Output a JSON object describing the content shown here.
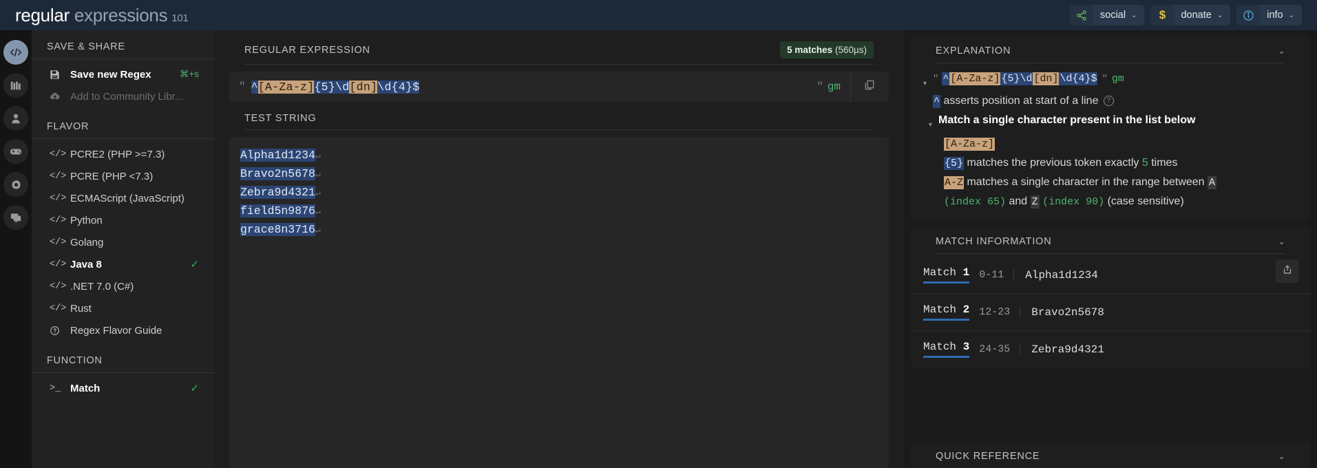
{
  "header": {
    "logo": {
      "word1": "regular",
      "word2": "expressions",
      "num": "101"
    },
    "actions": [
      {
        "icon": "share-nodes-icon",
        "glyph": "⑃",
        "label": "social",
        "caret": "⌄",
        "color": "#6fbf52"
      },
      {
        "icon": "dollar-icon",
        "glyph": "$",
        "label": "donate",
        "caret": "⌄",
        "color": "#e6c239"
      },
      {
        "icon": "info-circle-icon",
        "glyph": "ⓘ",
        "label": "info",
        "caret": "⌄",
        "color": "#5fb4e0"
      }
    ]
  },
  "rail": {
    "items": [
      {
        "name": "code-icon",
        "active": true
      },
      {
        "name": "library-icon",
        "active": false
      },
      {
        "name": "account-icon",
        "active": false
      },
      {
        "name": "gamepad-icon",
        "active": false
      },
      {
        "name": "settings-gear-icon",
        "active": false
      },
      {
        "name": "comments-icon",
        "active": false
      }
    ]
  },
  "sidebar": {
    "save_share_title": "SAVE & SHARE",
    "save_new_regex": {
      "label": "Save new Regex",
      "shortcut": "⌘+s",
      "icon": "floppy-disk-icon"
    },
    "add_community": {
      "label": "Add to Community Libr...",
      "icon": "cloud-upload-icon"
    },
    "flavor_title": "FLAVOR",
    "flavors": [
      {
        "label": "PCRE2 (PHP >=7.3)",
        "selected": false
      },
      {
        "label": "PCRE (PHP <7.3)",
        "selected": false
      },
      {
        "label": "ECMAScript (JavaScript)",
        "selected": false
      },
      {
        "label": "Python",
        "selected": false
      },
      {
        "label": "Golang",
        "selected": false
      },
      {
        "label": "Java 8",
        "selected": true
      },
      {
        "label": ".NET 7.0 (C#)",
        "selected": false
      },
      {
        "label": "Rust",
        "selected": false
      }
    ],
    "flavor_guide": {
      "label": "Regex Flavor Guide",
      "icon": "question-circle-icon"
    },
    "function_title": "FUNCTION",
    "functions": [
      {
        "label": "Match",
        "selected": true,
        "icon": "terminal-icon"
      }
    ],
    "check_glyph": "✓"
  },
  "editor": {
    "regex_title": "REGULAR EXPRESSION",
    "match_count": "5 matches",
    "match_time": "(560µs)",
    "quote": "\"",
    "regex_tokens": [
      {
        "text": "^",
        "style": "b"
      },
      {
        "text": "[A-Za-z]",
        "style": "t"
      },
      {
        "text": "{5}\\d",
        "style": "b"
      },
      {
        "text": "[dn]",
        "style": "t"
      },
      {
        "text": "\\d{4}$",
        "style": "b"
      }
    ],
    "flags": "gm",
    "copy_icon": "copy-icon",
    "test_title": "TEST STRING",
    "test_lines": [
      "Alpha1d1234",
      "Bravo2n5678",
      "Zebra9d4321",
      "field5n9876",
      "grace8n3716"
    ],
    "pilcrow": "↵"
  },
  "explanation": {
    "title": "EXPLANATION",
    "chevron": "⌄",
    "flags": "gm",
    "quote": "\"",
    "rows": {
      "caret_assert_token": "^",
      "caret_assert_text": "asserts position at start of a line",
      "list_title": "Match a single character present in the list below",
      "class_token": "[A-Za-z]",
      "quant_token": "{5}",
      "quant_text_a": "matches the previous token exactly",
      "quant_count": "5",
      "quant_text_b": "times",
      "range_token": "A-Z",
      "range_text_a": "matches a single character in the range between",
      "range_char_a": "A",
      "range_index_a": "(index 65)",
      "range_and": "and",
      "range_char_b": "Z",
      "range_index_b": "(index 90)",
      "range_sensitivity": "(case sensitive)"
    }
  },
  "match_info": {
    "title": "MATCH INFORMATION",
    "chevron": "⌄",
    "share_icon": "export-icon",
    "matches": [
      {
        "label": "Match",
        "n": "1",
        "range": "0-11",
        "value": "Alpha1d1234"
      },
      {
        "label": "Match",
        "n": "2",
        "range": "12-23",
        "value": "Bravo2n5678"
      },
      {
        "label": "Match",
        "n": "3",
        "range": "24-35",
        "value": "Zebra9d4321"
      }
    ]
  },
  "quick_reference": {
    "title": "QUICK REFERENCE",
    "chevron": "⌄"
  }
}
